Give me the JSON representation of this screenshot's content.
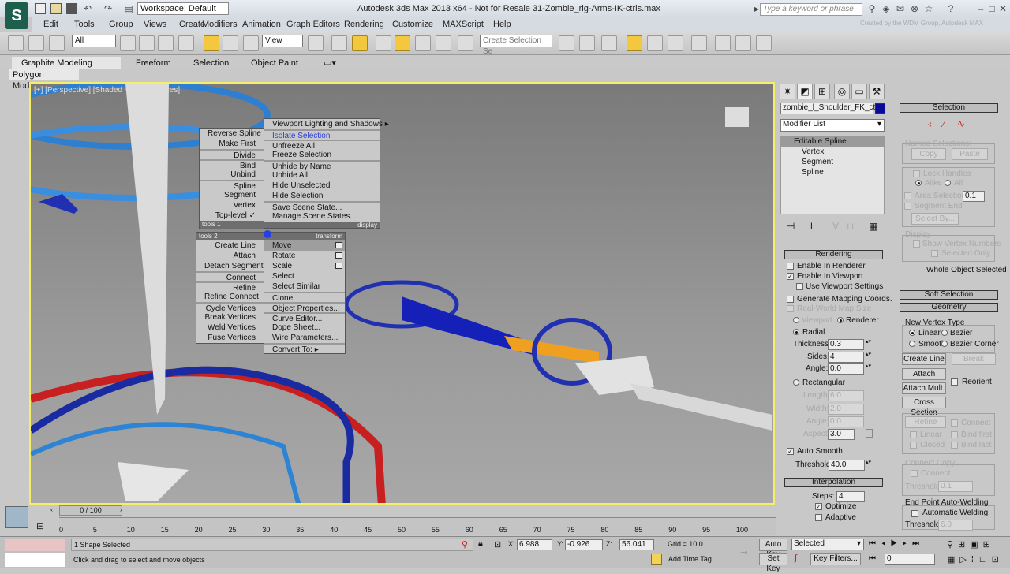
{
  "titlebar": {
    "workspace": "Workspace: Default",
    "title": "Autodesk 3ds Max 2013 x64 - Not for Resale   31-Zombie_rig-Arms-IK-ctrls.max",
    "search_placeholder": "Type a keyword or phrase",
    "watermark": "Created by the WDM Group, Autodesk MAX"
  },
  "menubar": [
    "Edit",
    "Tools",
    "Group",
    "Views",
    "Create",
    "Modifiers",
    "Animation",
    "Graph Editors",
    "Rendering",
    "Customize",
    "MAXScript",
    "Help"
  ],
  "toolbar": {
    "selection_filter": "All",
    "ref_coord": "View",
    "named_selection": "Create Selection Se"
  },
  "ribbon": {
    "tabs": [
      "Graphite Modeling Tools",
      "Freeform",
      "Selection",
      "Object Paint"
    ],
    "panel": "Polygon Modeling"
  },
  "viewport": {
    "label": "[+] [Perspective] [Shaded + Edged Faces]"
  },
  "quad": {
    "top_left": [
      {
        "t": "Reverse Spline"
      },
      {
        "t": "Make First"
      },
      {
        "t": "Divide",
        "sep": true
      },
      {
        "t": "Bind",
        "sep": true
      },
      {
        "t": "Unbind"
      },
      {
        "t": "Spline",
        "sep": true
      },
      {
        "t": "Segment"
      },
      {
        "t": "Vertex"
      },
      {
        "t": "Top-level ✓"
      }
    ],
    "top_left_head": "tools 1",
    "top_right": [
      {
        "t": "Viewport Lighting and Shadows ▸"
      },
      {
        "t": "Isolate Selection",
        "sep": true,
        "hl": true
      },
      {
        "t": "Unfreeze All",
        "sep": true
      },
      {
        "t": "Freeze Selection"
      },
      {
        "t": "Unhide by Name",
        "sep": true
      },
      {
        "t": "Unhide All"
      },
      {
        "t": "Hide Unselected"
      },
      {
        "t": "Hide Selection"
      },
      {
        "t": "Save Scene State...",
        "sep": true
      },
      {
        "t": "Manage Scene States..."
      }
    ],
    "top_right_head": "display",
    "bottom_left_head": "tools 2",
    "bottom_left": [
      {
        "t": "Create Line"
      },
      {
        "t": "Attach"
      },
      {
        "t": "Detach Segment"
      },
      {
        "t": "Connect",
        "sep": true
      },
      {
        "t": "Refine",
        "sep": true
      },
      {
        "t": "Refine Connect"
      },
      {
        "t": "Cycle Vertices",
        "sep": true
      },
      {
        "t": "Break Vertices"
      },
      {
        "t": "Weld Vertices"
      },
      {
        "t": "Fuse Vertices"
      }
    ],
    "bottom_right_head": "transform",
    "bottom_right": [
      {
        "t": "Move",
        "hov": true,
        "box": true
      },
      {
        "t": "Rotate",
        "box": true
      },
      {
        "t": "Scale",
        "box": true
      },
      {
        "t": "Select"
      },
      {
        "t": "Select Similar"
      },
      {
        "t": "Clone",
        "sep": true
      },
      {
        "t": "Object Properties...",
        "sep": true
      },
      {
        "t": "Curve Editor...",
        "sep": true
      },
      {
        "t": "Dope Sheet..."
      },
      {
        "t": "Wire Parameters..."
      },
      {
        "t": "Convert To: ▸",
        "sep": true
      }
    ]
  },
  "cmd": {
    "object_name": "zombie_l_Shoulder_FK_ctrl",
    "object_color": "#0a0a9a",
    "modifier_list": "Modifier List",
    "stack": [
      "Editable Spline",
      "Vertex",
      "Segment",
      "Spline"
    ],
    "rendering": {
      "title": "Rendering",
      "enable_renderer": "Enable In Renderer",
      "enable_viewport": "Enable In Viewport",
      "use_viewport": "Use Viewport Settings",
      "gen_mapping": "Generate Mapping Coords.",
      "real_world": "Real-World Map Size",
      "viewport": "Viewport",
      "renderer": "Renderer",
      "radial": "Radial",
      "thickness_l": "Thickness:",
      "thickness": "0.3",
      "sides_l": "Sides:",
      "sides": "4",
      "angle_l": "Angle:",
      "angle": "0.0",
      "rectangular": "Rectangular",
      "length_l": "Length:",
      "length": "6.0",
      "width_l": "Width:",
      "width": "2.0",
      "angle2_l": "Angle:",
      "angle2": "0.0",
      "aspect_l": "Aspect:",
      "aspect": "3.0",
      "auto_smooth": "Auto Smooth",
      "threshold_l": "Threshold:",
      "threshold": "40.0"
    },
    "interpolation": {
      "title": "Interpolation",
      "steps_l": "Steps:",
      "steps": "4",
      "optimize": "Optimize",
      "adaptive": "Adaptive"
    },
    "selection": {
      "title": "Selection",
      "named": "Named Selections:",
      "copy": "Copy",
      "paste": "Paste",
      "lock_handles": "Lock Handles",
      "alike": "Alike",
      "all": "All",
      "area_sel": "Area Selection:",
      "area_val": "0.1",
      "segment_end": "Segment End",
      "select_by": "Select By...",
      "display": "Display",
      "show_vnums": "Show Vertex Numbers",
      "selected_only": "Selected Only",
      "status": "Whole Object Selected"
    },
    "soft_selection": "Soft Selection",
    "geometry": {
      "title": "Geometry",
      "nvt": "New Vertex Type",
      "linear": "Linear",
      "bezier": "Bezier",
      "smooth": "Smooth",
      "bezier_corner": "Bezier Corner",
      "create_line": "Create Line",
      "break": "Break",
      "attach": "Attach",
      "reorient": "Reorient",
      "attach_mult": "Attach Mult.",
      "cross_section": "Cross Section",
      "refine": "Refine",
      "connect": "Connect",
      "linear2": "Linear",
      "bind_first": "Bind first",
      "closed": "Closed",
      "bind_last": "Bind last",
      "connect_copy": "Connect Copy",
      "connect2": "Connect",
      "threshold_l": "Threshold",
      "threshold": "0.1",
      "epaw": "End Point Auto-Welding",
      "auto_weld": "Automatic Welding",
      "threshold2_l": "Threshold",
      "threshold2": "6.0"
    }
  },
  "timeline": {
    "slider": "0 / 100",
    "ticks": [
      "0",
      "5",
      "10",
      "15",
      "20",
      "25",
      "30",
      "35",
      "40",
      "45",
      "50",
      "55",
      "60",
      "65",
      "70",
      "75",
      "80",
      "85",
      "90",
      "95",
      "100"
    ]
  },
  "status": {
    "selected": "1 Shape Selected",
    "prompt": "Click and drag to select and move objects",
    "x_l": "X:",
    "x": "6.988",
    "y_l": "Y:",
    "y": "-0.926",
    "z_l": "Z:",
    "z": "56.041",
    "grid": "Grid = 10.0",
    "add_time_tag": "Add Time Tag",
    "auto_key": "Auto Key",
    "set_key": "Set Key",
    "key_mode": "Selected",
    "key_filters": "Key Filters...",
    "frame": "0"
  }
}
